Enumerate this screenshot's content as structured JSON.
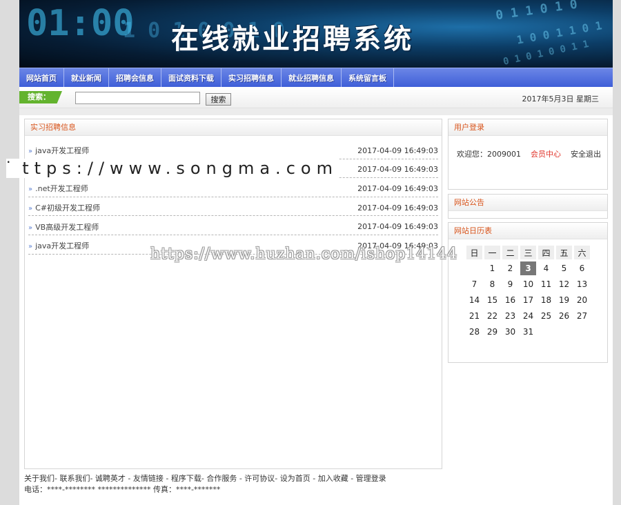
{
  "banner": {
    "title": "在线就业招聘系统",
    "digits_1": "01:00",
    "digits_2": "1 0 1 0 0 1 0",
    "digits_3": "0 1 1 0 1 0",
    "digits_4": "1 0 0 1 1 0 1",
    "digits_5": "0 1 0 1 0 0 1 1"
  },
  "nav": {
    "items": [
      "网站首页",
      "就业新闻",
      "招聘会信息",
      "面试资料下载",
      "实习招聘信息",
      "就业招聘信息",
      "系统留言板"
    ]
  },
  "search": {
    "label": "搜索：",
    "value": "",
    "placeholder": "",
    "button": "搜索",
    "date": "2017年5月3日 星期三"
  },
  "main": {
    "title": "实习招聘信息",
    "jobs": [
      {
        "title": "java开发工程师",
        "date": "2017-04-09 16:49:03"
      },
      {
        "title": "",
        "date": "2017-04-09 16:49:03"
      },
      {
        "title": ".net开发工程师",
        "date": "2017-04-09 16:49:03"
      },
      {
        "title": "C#初级开发工程师",
        "date": "2017-04-09 16:49:03"
      },
      {
        "title": "VB高级开发工程师",
        "date": "2017-04-09 16:49:03"
      },
      {
        "title": "java开发工程师",
        "date": "2017-04-09 16:49:03"
      }
    ]
  },
  "login": {
    "title": "用户登录",
    "welcome": "欢迎您：2009001",
    "member_center": "会员中心",
    "logout": "安全退出"
  },
  "notice": {
    "title": "网站公告"
  },
  "calendar": {
    "title": "网站日历表",
    "weekdays": [
      "日",
      "一",
      "二",
      "三",
      "四",
      "五",
      "六"
    ],
    "weeks": [
      [
        "",
        "1",
        "2",
        "3",
        "4",
        "5",
        "6"
      ],
      [
        "7",
        "8",
        "9",
        "10",
        "11",
        "12",
        "13"
      ],
      [
        "14",
        "15",
        "16",
        "17",
        "18",
        "19",
        "20"
      ],
      [
        "21",
        "22",
        "23",
        "24",
        "25",
        "26",
        "27"
      ],
      [
        "28",
        "29",
        "30",
        "31",
        "",
        "",
        ""
      ]
    ],
    "today": "3"
  },
  "footer": {
    "links_line": "关于我们- 联系我们- 诚聘英才 - 友情链接 - 程序下载- 合作服务 - 许可协议- 设为首页 - 加入收藏 - 管理登录",
    "contact_line": "电话：****-******** ************** 传真：****-*******"
  },
  "watermarks": {
    "songma": "https://www.songma.com",
    "huzhan": "https://www.huzhan.com/ishop14144"
  }
}
